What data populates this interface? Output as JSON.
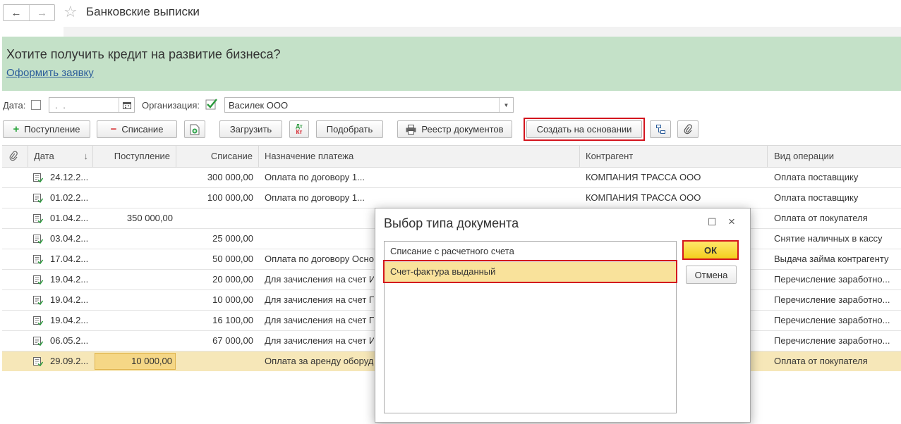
{
  "header": {
    "back_icon": "←",
    "forward_icon": "→",
    "favorite_icon": "☆",
    "title": "Банковские выписки"
  },
  "banner": {
    "question": "Хотите получить кредит на развитие бизнеса?",
    "link": "Оформить заявку",
    "color": "#c4e1c8"
  },
  "filters": {
    "date_label": "Дата:",
    "date_value": ". .",
    "org_label": "Организация:",
    "org_value": "Василек ООО"
  },
  "toolbar": {
    "receipt": "Поступление",
    "writeoff": "Списание",
    "load": "Загрузить",
    "select": "Подобрать",
    "registry": "Реестр документов",
    "create_based": "Создать на основании",
    "dtkt_dt": "Дт",
    "dtkt_kt": "Кт"
  },
  "table": {
    "columns": {
      "date": "Дата",
      "date_sort": "↓",
      "receipt": "Поступление",
      "writeoff": "Списание",
      "purpose": "Назначение платежа",
      "counterparty": "Контрагент",
      "operation": "Вид операции"
    },
    "rows": [
      {
        "date": "24.12.2...",
        "receipt": "",
        "writeoff": "300 000,00",
        "purpose": "Оплата по договору 1...",
        "counterparty": "КОМПАНИЯ ТРАССА ООО",
        "operation": "Оплата поставщику"
      },
      {
        "date": "01.02.2...",
        "receipt": "",
        "writeoff": "100 000,00",
        "purpose": "Оплата по договору 1...",
        "counterparty": "КОМПАНИЯ ТРАССА ООО",
        "operation": "Оплата поставщику"
      },
      {
        "date": "01.04.2...",
        "receipt": "350 000,00",
        "writeoff": "",
        "purpose": "",
        "counterparty": "",
        "operation": "Оплата от покупателя"
      },
      {
        "date": "03.04.2...",
        "receipt": "",
        "writeoff": "25 000,00",
        "purpose": "",
        "counterparty": "",
        "operation": "Снятие наличных в кассу"
      },
      {
        "date": "17.04.2...",
        "receipt": "",
        "writeoff": "50 000,00",
        "purpose": "Оплата по договору Осно",
        "counterparty": "",
        "operation": "Выдача займа контрагенту"
      },
      {
        "date": "19.04.2...",
        "receipt": "",
        "writeoff": "20 000,00",
        "purpose": "Для зачисления на счет И",
        "counterparty": "",
        "operation": "Перечисление заработно..."
      },
      {
        "date": "19.04.2...",
        "receipt": "",
        "writeoff": "10 000,00",
        "purpose": "Для зачисления на счет П",
        "counterparty": "",
        "operation": "Перечисление заработно..."
      },
      {
        "date": "19.04.2...",
        "receipt": "",
        "writeoff": "16 100,00",
        "purpose": "Для зачисления на счет П",
        "counterparty": "",
        "operation": "Перечисление заработно..."
      },
      {
        "date": "06.05.2...",
        "receipt": "",
        "writeoff": "67 000,00",
        "purpose": "Для зачисления на счет И",
        "counterparty": "",
        "operation": "Перечисление заработно..."
      },
      {
        "date": "29.09.2...",
        "receipt": "10 000,00",
        "writeoff": "",
        "purpose": "Оплата за аренду оборуд",
        "counterparty": "",
        "operation": "Оплата от покупателя"
      }
    ]
  },
  "dialog": {
    "title": "Выбор типа документа",
    "maximize_icon": "☐",
    "close_icon": "×",
    "options": [
      "Списание с расчетного счета",
      "Счет-фактура выданный"
    ],
    "selected_index": 1,
    "ok": "ОК",
    "cancel": "Отмена"
  },
  "colors": {
    "highlight_frame": "#d3151e",
    "selected_row": "#f6e7b8",
    "ok_button": "#f4cf1d"
  }
}
